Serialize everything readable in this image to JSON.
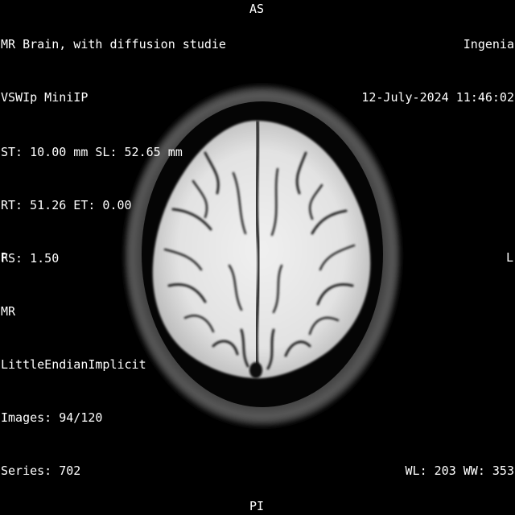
{
  "overlay": {
    "top_left": {
      "study_description": "MR Brain, with diffusion studie",
      "series_description": "VSWIp MiniIP"
    },
    "top_right": {
      "institution": "Ingenia",
      "datetime": "12-July-2024 11:46:02"
    },
    "bottom_left": {
      "thickness_location": "ST: 10.00 mm SL: 52.65 mm",
      "rt_et": "RT: 51.26 ET: 0.00",
      "fs": "FS: 1.50",
      "modality": "MR",
      "transfer_syntax": "LittleEndianImplicit",
      "images": "Images: 94/120",
      "series": "Series: 702"
    },
    "bottom_right": {
      "window": "WL: 203 WW: 353"
    },
    "orientation": {
      "top": "AS",
      "bottom": "PI",
      "left": "R",
      "right": "L"
    }
  },
  "image": {
    "description_icon": "mri-axial-brain-slice",
    "background_color": "#000000",
    "tissue_color": "#e8e8e8"
  }
}
